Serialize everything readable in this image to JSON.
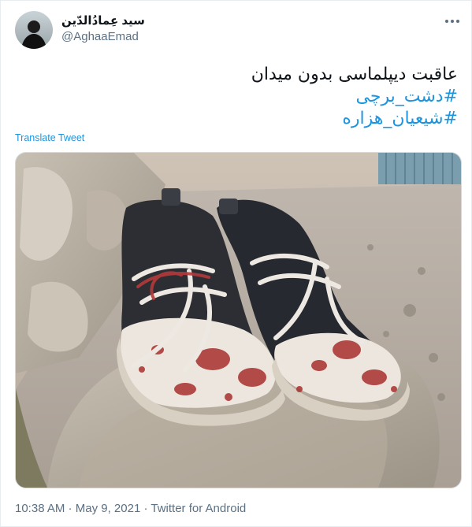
{
  "author": {
    "display_name": "سید عِمادُالدّین",
    "handle": "@AghaaEmad"
  },
  "tweet": {
    "line1": "عاقبت دیپلماسی بدون میدان",
    "hashtag1": "#دشت_برچی",
    "hashtag2": "#شیعیان_هزاره"
  },
  "translate_label": "Translate Tweet",
  "media": {
    "description_icon": "blood-stained-shoes-photo"
  },
  "footer": {
    "time": "10:38 AM",
    "sep1": " · ",
    "date": "May 9, 2021",
    "sep2": " · ",
    "source": "Twitter for Android"
  },
  "colors": {
    "link": "#1b95e0",
    "secondary_text": "#5b7083"
  }
}
